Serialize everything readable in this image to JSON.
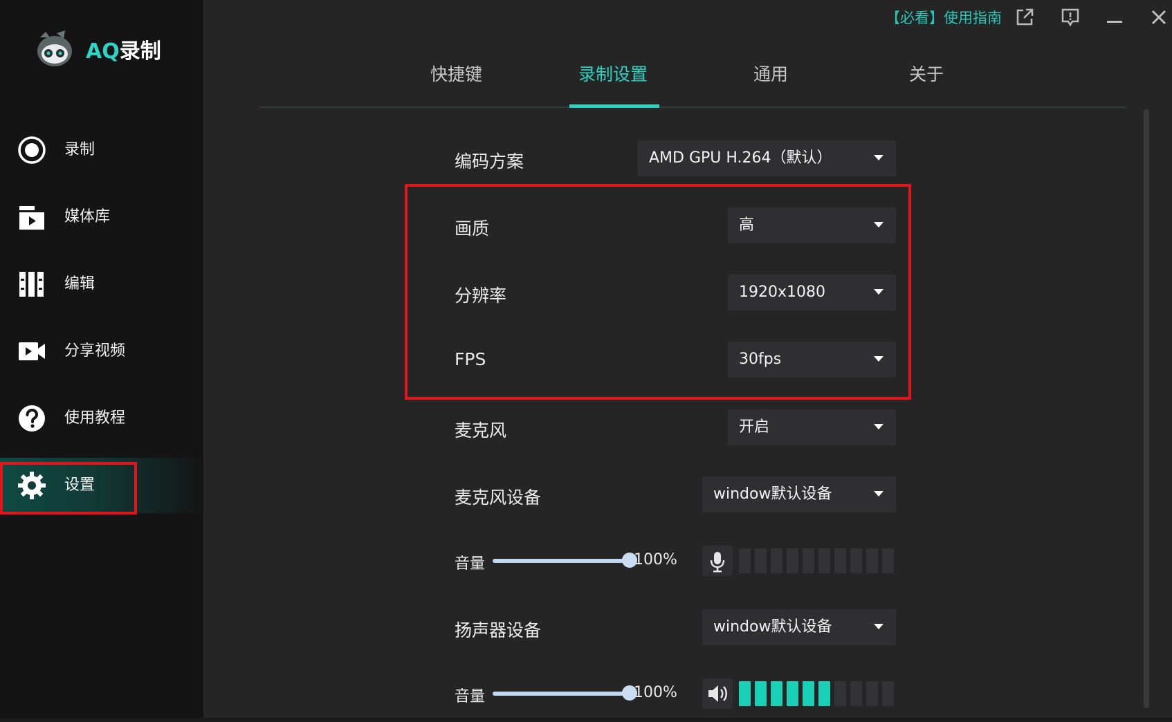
{
  "app": {
    "name_prefix": "AQ",
    "name_suffix": "录制"
  },
  "title_bar": {
    "guide_link": "【必看】使用指南"
  },
  "sidebar": {
    "items": [
      {
        "label": "录制",
        "icon": "record-icon"
      },
      {
        "label": "媒体库",
        "icon": "media-library-icon"
      },
      {
        "label": "编辑",
        "icon": "edit-icon"
      },
      {
        "label": "分享视频",
        "icon": "video-camera-icon"
      },
      {
        "label": "使用教程",
        "icon": "help-icon"
      },
      {
        "label": "设置",
        "icon": "gear-icon",
        "active": true
      }
    ]
  },
  "tabs": [
    {
      "label": "快捷键"
    },
    {
      "label": "录制设置",
      "active": true
    },
    {
      "label": "通用"
    },
    {
      "label": "关于"
    }
  ],
  "settings": {
    "encoding": {
      "label": "编码方案",
      "value": "AMD GPU H.264（默认）"
    },
    "quality": {
      "label": "画质",
      "value": "高"
    },
    "resolution": {
      "label": "分辨率",
      "value": "1920x1080"
    },
    "fps": {
      "label": "FPS",
      "value": "30fps"
    },
    "mic": {
      "label": "麦克风",
      "value": "开启"
    },
    "mic_device": {
      "label": "麦克风设备",
      "value": "window默认设备"
    },
    "mic_volume": {
      "label": "音量",
      "value_text": "100%",
      "value": 1.0,
      "meter_active": 0,
      "meter_total": 10
    },
    "speaker_device": {
      "label": "扬声器设备",
      "value": "window默认设备"
    },
    "speaker_volume": {
      "label": "音量",
      "value_text": "100%",
      "value": 1.0,
      "meter_active": 6,
      "meter_total": 10
    }
  },
  "colors": {
    "accent": "#2ed3c3",
    "highlight": "#e2151c",
    "meter_on": "#19d0b6"
  }
}
